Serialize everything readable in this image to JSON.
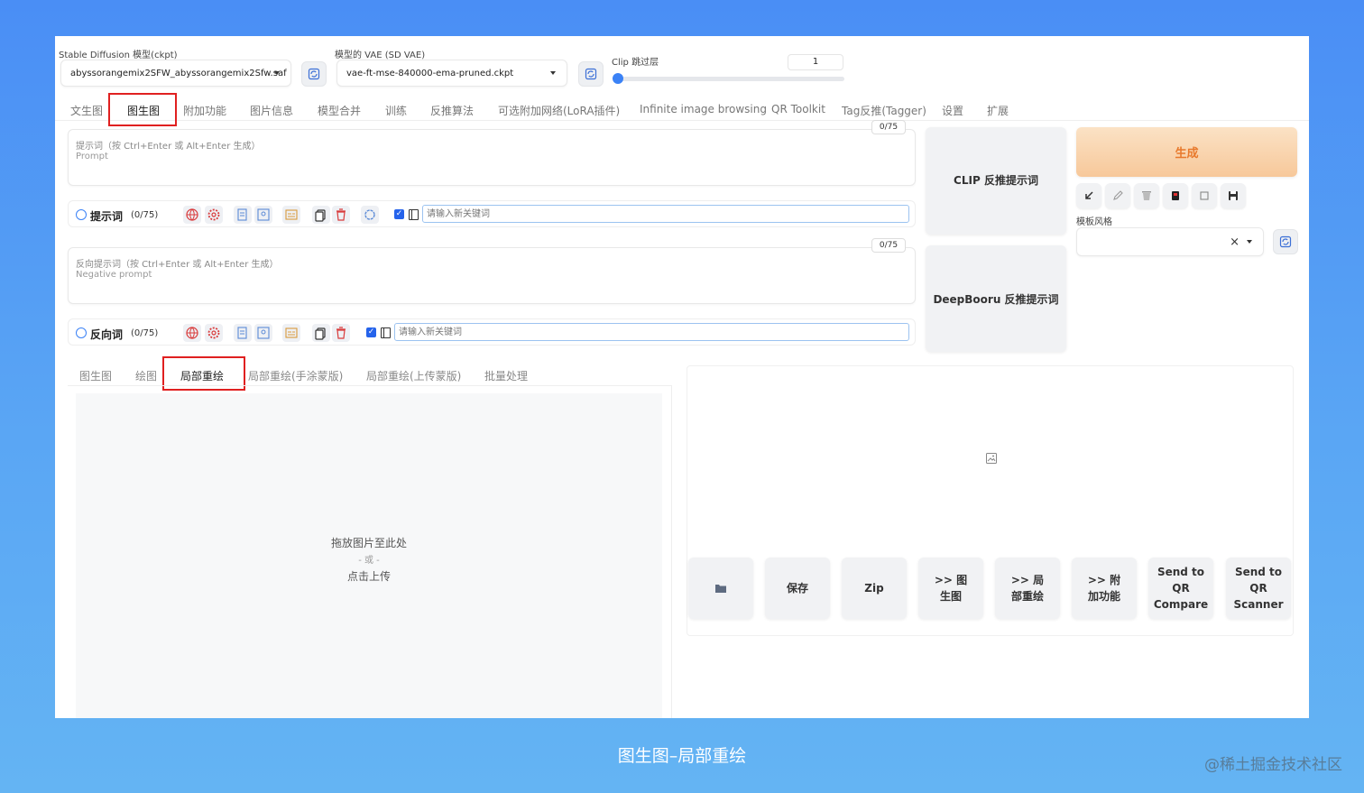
{
  "top": {
    "ckpt_label": "Stable Diffusion 模型(ckpt)",
    "ckpt_value": "abyssorangemix2SFW_abyssorangemix2Sfw.saf",
    "vae_label": "模型的 VAE (SD VAE)",
    "vae_value": "vae-ft-mse-840000-ema-pruned.ckpt",
    "clip_label": "Clip 跳过层",
    "clip_value": "1",
    "clip_fraction": 0.0
  },
  "tabs": [
    "文生图",
    "图生图",
    "附加功能",
    "图片信息",
    "模型合并",
    "训练",
    "反推算法",
    "可选附加网络(LoRA插件)",
    "Infinite image browsing",
    "QR Toolkit",
    "Tag反推(Tagger)",
    "设置",
    "扩展"
  ],
  "prompt": {
    "placeholder_cn": "提示词（按 Ctrl+Enter 或 Alt+Enter 生成）",
    "placeholder_en": "Prompt",
    "counter": "0/75",
    "row_label": "提示词",
    "row_count": "(0/75)",
    "keyword_placeholder": "请输入新关键词"
  },
  "negative": {
    "placeholder_cn": "反向提示词（按 Ctrl+Enter 或 Alt+Enter 生成）",
    "placeholder_en": "Negative prompt",
    "counter": "0/75",
    "row_label": "反向词",
    "row_count": "(0/75)",
    "keyword_placeholder": "请输入新关键词"
  },
  "interrogate": {
    "clip": "CLIP 反推提示词",
    "deepbooru": "DeepBooru 反推提示词"
  },
  "generate": {
    "label": "生成",
    "style_label": "模板风格",
    "clear_symbol": "×"
  },
  "subtabs": [
    "图生图",
    "绘图",
    "局部重绘",
    "局部重绘(手涂蒙版)",
    "局部重绘(上传蒙版)",
    "批量处理"
  ],
  "upload": {
    "line1": "拖放图片至此处",
    "line2": "- 或 -",
    "line3": "点击上传"
  },
  "output_buttons": {
    "save": "保存",
    "zip": "Zip",
    "to_img2img": ">> 图生图",
    "to_inpaint": ">> 局部重绘",
    "to_extras": ">> 附加功能",
    "qr_compare": "Send to QR Compare",
    "qr_scanner": "Send to QR Scanner"
  },
  "caption": "图生图–局部重绘",
  "watermark": "@稀土掘金技术社区",
  "colors": {
    "background": "#4a8ef5",
    "accent": "#2563eb",
    "highlight_box": "#e02020",
    "generate_text": "#e8792c"
  }
}
